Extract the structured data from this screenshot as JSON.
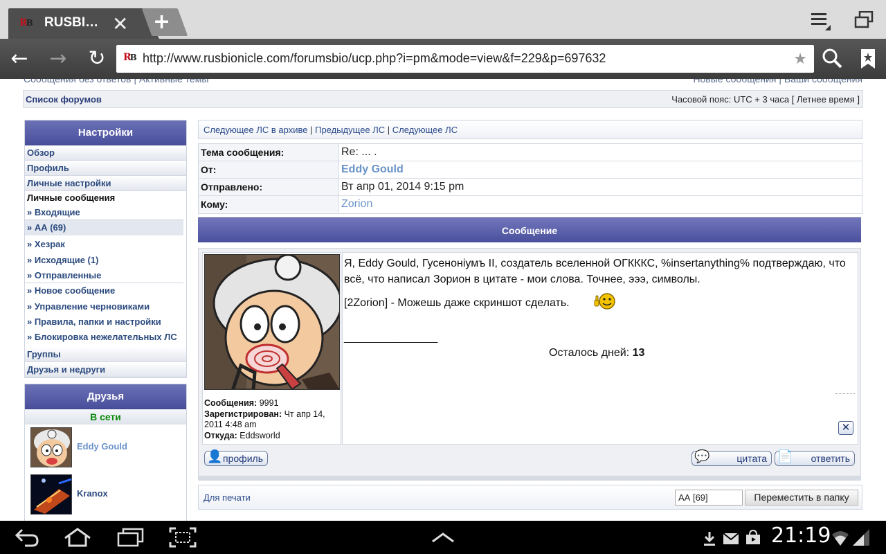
{
  "browser": {
    "tab_title": "RUSBI…",
    "tab_close": "✕",
    "new_tab": "+",
    "url": "http://www.rusbionicle.com/forumsbio/ucp.php?i=pm&mode=view&f=229&p=697632",
    "favicon_r": "R",
    "favicon_b": "B",
    "back": "←",
    "forward": "→",
    "reload": "↻",
    "star": "★",
    "icons": [
      "menu-icon",
      "windows-icon",
      "search-icon",
      "bookmark-icon"
    ]
  },
  "top_links": {
    "left": "Сообщения без ответов | Активные темы",
    "right": "Новые сообщения | Ваши сообщения"
  },
  "breadcrumb": {
    "forum_list": "Список форумов",
    "timezone": "Часовой пояс: UTC + 3 часа [ Летнее время ]"
  },
  "sidebar": {
    "header": "Настройки",
    "items_top": [
      "Обзор",
      "Профиль",
      "Личные настройки"
    ],
    "pm_category": "Личные сообщения",
    "pm_items": [
      "» Входящие",
      "» АА (69)",
      "» Хезрак",
      "» Исходящие (1)",
      "» Отправленные",
      "» Новое сообщение",
      "» Управление черновиками",
      "» Правила, папки и настройки",
      "» Блокировка нежелательных ЛС"
    ],
    "items_bottom": [
      "Группы",
      "Друзья и недруги"
    ]
  },
  "friends": {
    "header": "Друзья",
    "online_label": "В сети",
    "list": [
      {
        "name": "Eddy Gould",
        "color": "#6a93c8"
      },
      {
        "name": "Kranox",
        "color": "#2b4a7e"
      }
    ]
  },
  "pm_nav": {
    "next_archive": "Следующее ЛС в архиве",
    "sep": " | ",
    "prev": "Предыдущее ЛС",
    "next": "Следующее ЛС"
  },
  "pm_header": {
    "subject_label": "Тема сообщения:",
    "subject_value": "Re: ... .",
    "from_label": "От:",
    "from_value": "Eddy Gould",
    "sent_label": "Отправлено:",
    "sent_value": "Вт апр 01, 2014 9:15 pm",
    "to_label": "Кому:",
    "to_value": "Zorion"
  },
  "message": {
    "header": "Сообщение",
    "body": "Я, Eddy Gould, Гусеноніумъ II, создатель вселенной ОГКККС, %insertanything% подтверждаю, что всё, что написал Зорион в цитате - мои слова. Точнее, эээ, символы.",
    "quip": "[2Zorion] - Можешь даже скриншот сделать.",
    "sig_line": "_________________",
    "days_left_label": "Осталось дней:",
    "days_left_value": "13",
    "report": "✕"
  },
  "author": {
    "posts_label": "Сообщения:",
    "posts_value": "9991",
    "registered_label": "Зарегистрирован:",
    "registered_value": "Чт апр 14, 2011 4:48 am",
    "from_label": "Откуда:",
    "from_value": "Eddsworld"
  },
  "post_buttons": {
    "profile": "профиль",
    "quote": "цитата",
    "reply": "ответить"
  },
  "bottom": {
    "print": "Для печати",
    "folder_value": "АА [69]",
    "move_button": "Переместить в папку"
  },
  "status_bar": {
    "time": "21:19",
    "icons": [
      "back-icon",
      "home-icon",
      "recent-apps-icon",
      "screenshot-icon",
      "up-arrow-icon",
      "download-icon",
      "mail-icon",
      "shopping-bag-icon",
      "wifi-icon",
      "signal-icon"
    ]
  },
  "colors": {
    "accent": "#4a4f9c",
    "link": "#2b4a7e",
    "online": "#0a8a0a"
  }
}
